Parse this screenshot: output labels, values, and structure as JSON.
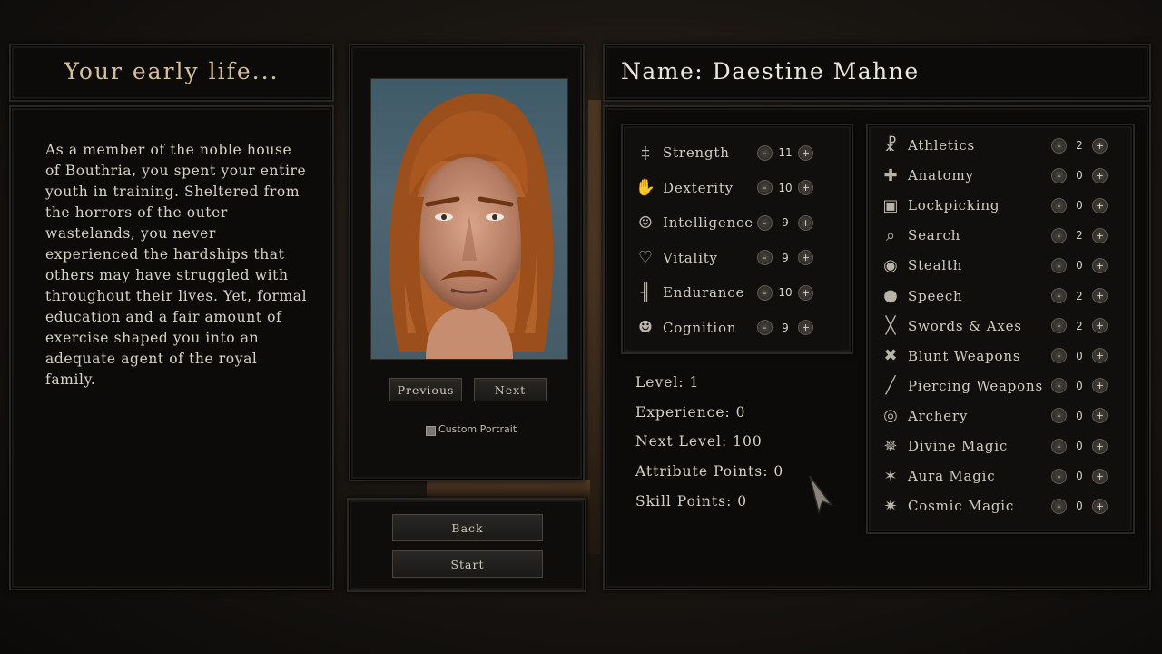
{
  "story": {
    "title": "Your early life...",
    "text": "As a member of the noble house of Bouthria, you spent your entire youth in training. Sheltered from the horrors of the outer wastelands, you never experienced the hardships that others may have struggled with throughout their lives. Yet, formal education and a fair amount of exercise shaped you into an adequate agent of the royal family."
  },
  "portrait": {
    "previous_label": "Previous",
    "next_label": "Next",
    "custom_label": "Custom Portrait"
  },
  "actions": {
    "back_label": "Back",
    "start_label": "Start"
  },
  "character": {
    "name_line": "Name: Daestine Mahne"
  },
  "attributes": [
    {
      "label": "Strength",
      "value": "11",
      "icon": "strength-icon"
    },
    {
      "label": "Dexterity",
      "value": "10",
      "icon": "dexterity-icon"
    },
    {
      "label": "Intelligence",
      "value": "9",
      "icon": "intelligence-icon"
    },
    {
      "label": "Vitality",
      "value": "9",
      "icon": "vitality-icon"
    },
    {
      "label": "Endurance",
      "value": "10",
      "icon": "endurance-icon"
    },
    {
      "label": "Cognition",
      "value": "9",
      "icon": "cognition-icon"
    }
  ],
  "stats": {
    "level": "Level: 1",
    "experience": "Experience: 0",
    "next_level": "Next Level: 100",
    "attribute_points": "Attribute Points: 0",
    "skill_points": "Skill Points: 0"
  },
  "skills": [
    {
      "label": "Athletics",
      "value": "2",
      "icon": "athletics-icon"
    },
    {
      "label": "Anatomy",
      "value": "0",
      "icon": "anatomy-icon"
    },
    {
      "label": "Lockpicking",
      "value": "0",
      "icon": "lock-icon"
    },
    {
      "label": "Search",
      "value": "2",
      "icon": "magnifier-icon"
    },
    {
      "label": "Stealth",
      "value": "0",
      "icon": "eye-icon"
    },
    {
      "label": "Speech",
      "value": "2",
      "icon": "speech-bubble-icon"
    },
    {
      "label": "Swords & Axes",
      "value": "2",
      "icon": "crossed-swords-icon"
    },
    {
      "label": "Blunt Weapons",
      "value": "0",
      "icon": "crossed-maces-icon"
    },
    {
      "label": "Piercing Weapons",
      "value": "0",
      "icon": "spear-icon"
    },
    {
      "label": "Archery",
      "value": "0",
      "icon": "target-icon"
    },
    {
      "label": "Divine Magic",
      "value": "0",
      "icon": "divine-star-icon"
    },
    {
      "label": "Aura Magic",
      "value": "0",
      "icon": "aura-star-icon"
    },
    {
      "label": "Cosmic Magic",
      "value": "0",
      "icon": "cosmic-star-icon"
    }
  ],
  "stepper": {
    "minus": "-",
    "plus": "+"
  },
  "colors": {
    "title_gold": "#d8bf9b",
    "panel_bg": "#0c0b0a",
    "text": "#d6d0c4"
  }
}
